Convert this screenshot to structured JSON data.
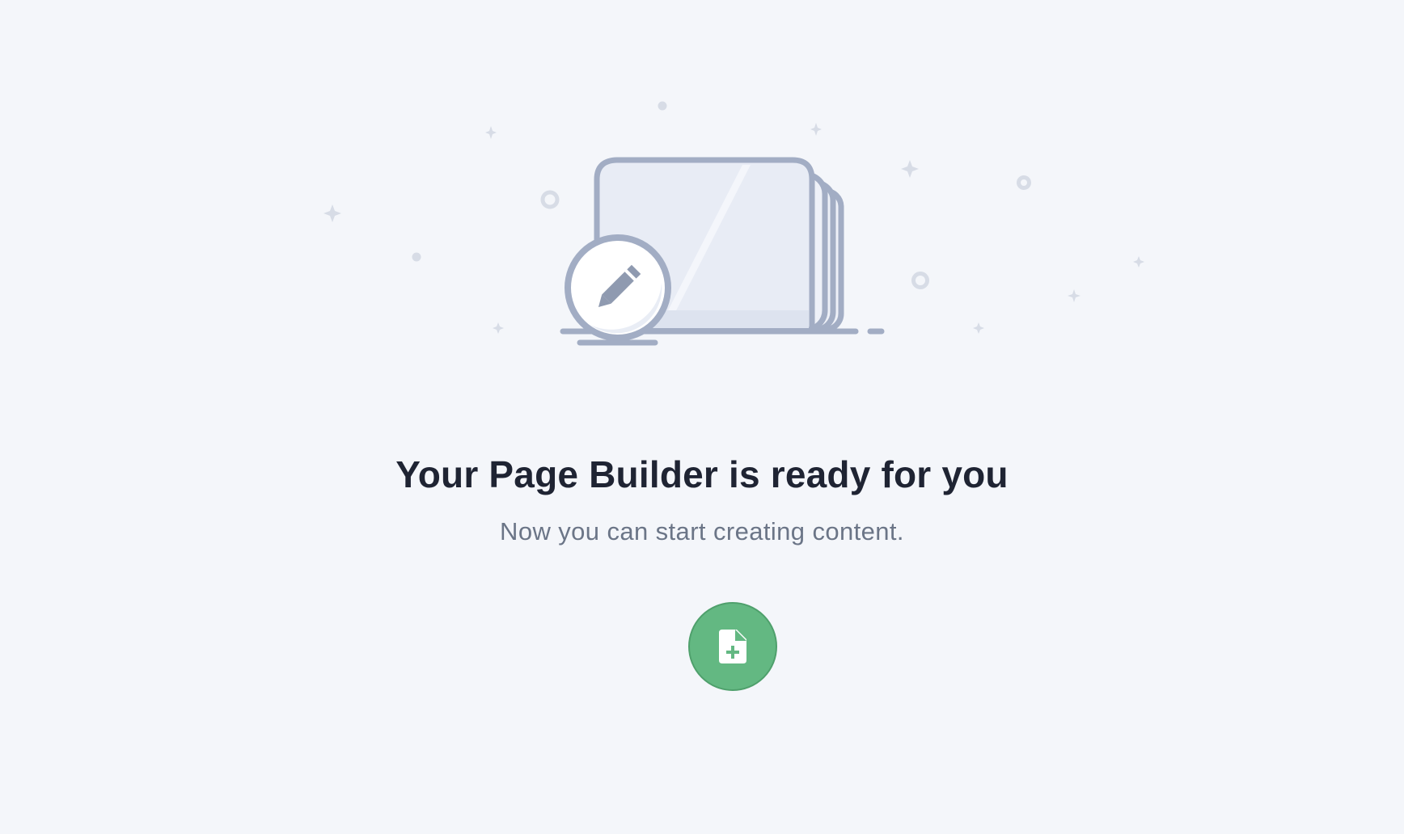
{
  "empty_state": {
    "title": "Your Page Builder is ready for you",
    "subtitle": "Now you can start creating content.",
    "illustration_icon": "pencil-icon",
    "button_icon": "file-plus-icon"
  },
  "colors": {
    "background": "#f4f6fa",
    "illustration_stroke": "#a2adc4",
    "illustration_fill": "#e8ecf5",
    "title": "#1f2433",
    "subtitle": "#6b7587",
    "accent_green": "#63b882"
  }
}
